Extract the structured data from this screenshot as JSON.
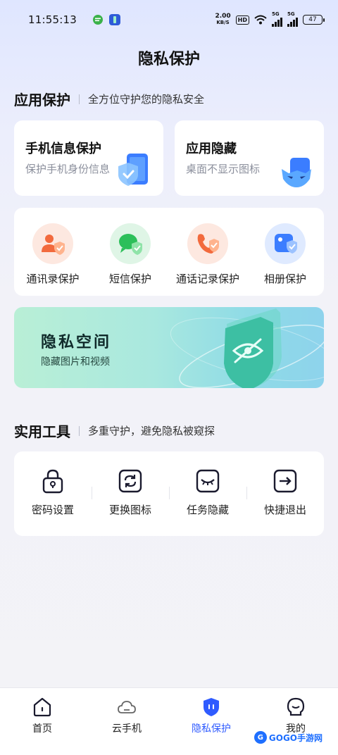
{
  "status_bar": {
    "time": "11:55:13",
    "net_speed_value": "2.00",
    "net_speed_unit": "KB/S",
    "hd_label": "HD",
    "sig1_label": "5G",
    "sig2_label": "5G",
    "battery": "47"
  },
  "page_title": "隐私保护",
  "app_protect": {
    "title": "应用保护",
    "subtitle": "全方位守护您的隐私安全",
    "card_phone": {
      "title": "手机信息保护",
      "subtitle": "保护手机身份信息"
    },
    "card_hide": {
      "title": "应用隐藏",
      "subtitle": "桌面不显示图标"
    },
    "grid": [
      {
        "label": "通讯录保护",
        "icon": "contacts-shield-icon"
      },
      {
        "label": "短信保护",
        "icon": "sms-shield-icon"
      },
      {
        "label": "通话记录保护",
        "icon": "call-log-shield-icon"
      },
      {
        "label": "相册保护",
        "icon": "album-shield-icon"
      }
    ]
  },
  "banner": {
    "title": "隐私空间",
    "subtitle": "隐藏图片和视频"
  },
  "tools": {
    "title": "实用工具",
    "subtitle": "多重守护，避免隐私被窥探",
    "items": [
      {
        "label": "密码设置",
        "icon": "lock-icon"
      },
      {
        "label": "更换图标",
        "icon": "refresh-icon"
      },
      {
        "label": "任务隐藏",
        "icon": "closed-eye-icon"
      },
      {
        "label": "快捷退出",
        "icon": "exit-arrow-icon"
      }
    ]
  },
  "tabbar": {
    "items": [
      {
        "label": "首页",
        "icon": "home-icon"
      },
      {
        "label": "云手机",
        "icon": "cloud-icon"
      },
      {
        "label": "隐私保护",
        "icon": "shield-icon",
        "active": true
      },
      {
        "label": "我的",
        "icon": "profile-icon"
      }
    ]
  },
  "watermark": {
    "text": "GOGO手游网",
    "badge": "G"
  },
  "colors": {
    "accent": "#2f5bff",
    "banner_start": "#b9efd6",
    "banner_end": "#8ed3ec"
  }
}
